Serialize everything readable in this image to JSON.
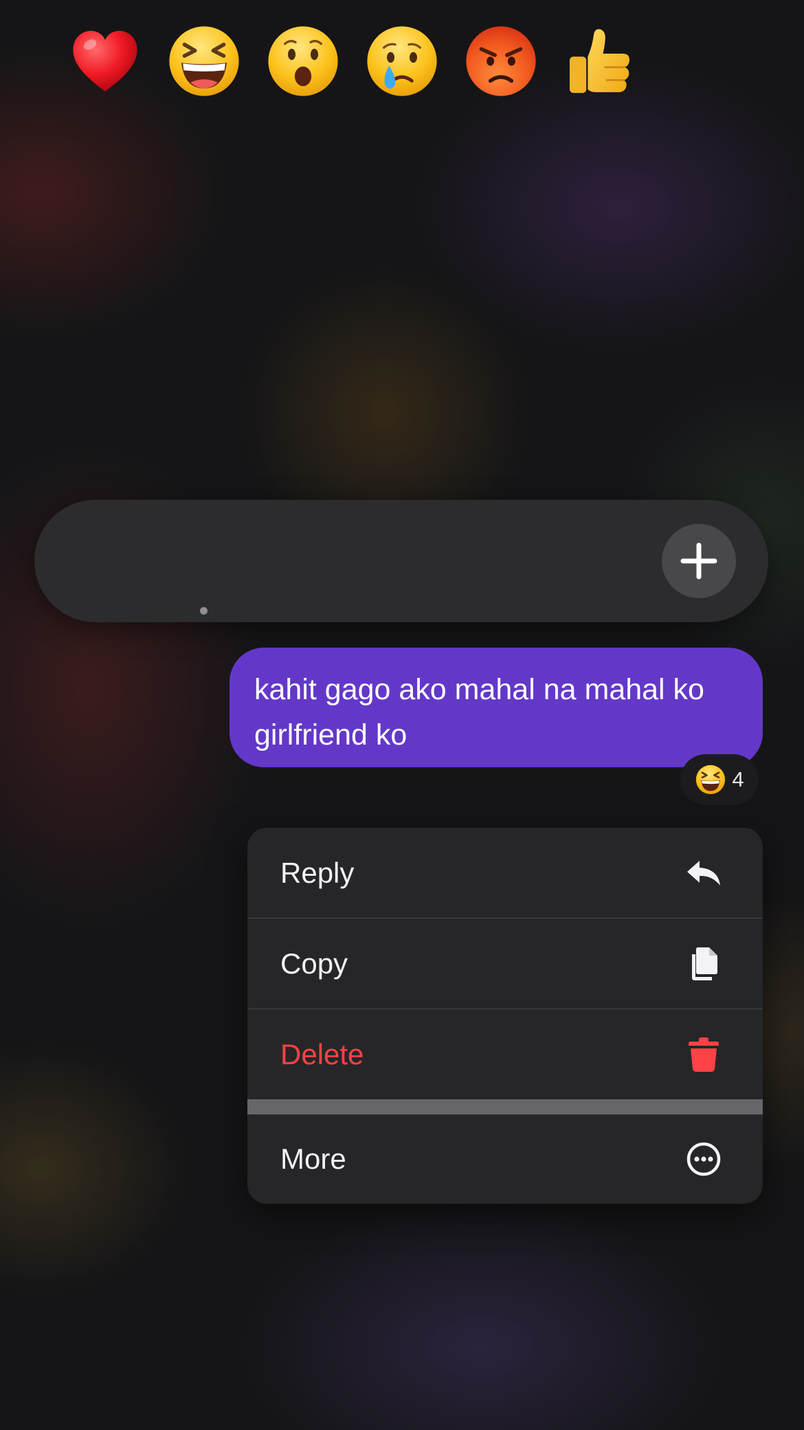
{
  "reaction_tray": {
    "reactions": [
      {
        "emoji": "❤️",
        "icon": "heart-icon"
      },
      {
        "emoji": "😆",
        "icon": "laughing-face-icon",
        "selected": true
      },
      {
        "emoji": "😮",
        "icon": "surprised-face-icon"
      },
      {
        "emoji": "😢",
        "icon": "crying-face-icon"
      },
      {
        "emoji": "😡",
        "icon": "angry-face-icon"
      },
      {
        "emoji": "👍",
        "icon": "thumbs-up-icon"
      }
    ],
    "add_icon": "plus-icon"
  },
  "message": {
    "text": "kahit gago ako mahal na mahal ko girlfriend ko",
    "bubble_color": "#6338c9",
    "reaction": {
      "emoji": "😆",
      "count": "4"
    }
  },
  "context_menu": {
    "items": [
      {
        "label": "Reply",
        "icon": "reply-icon"
      },
      {
        "label": "Copy",
        "icon": "copy-icon"
      },
      {
        "label": "Delete",
        "icon": "trash-icon",
        "color": "#ff4245"
      },
      {
        "label": "More",
        "icon": "more-icon"
      }
    ]
  }
}
